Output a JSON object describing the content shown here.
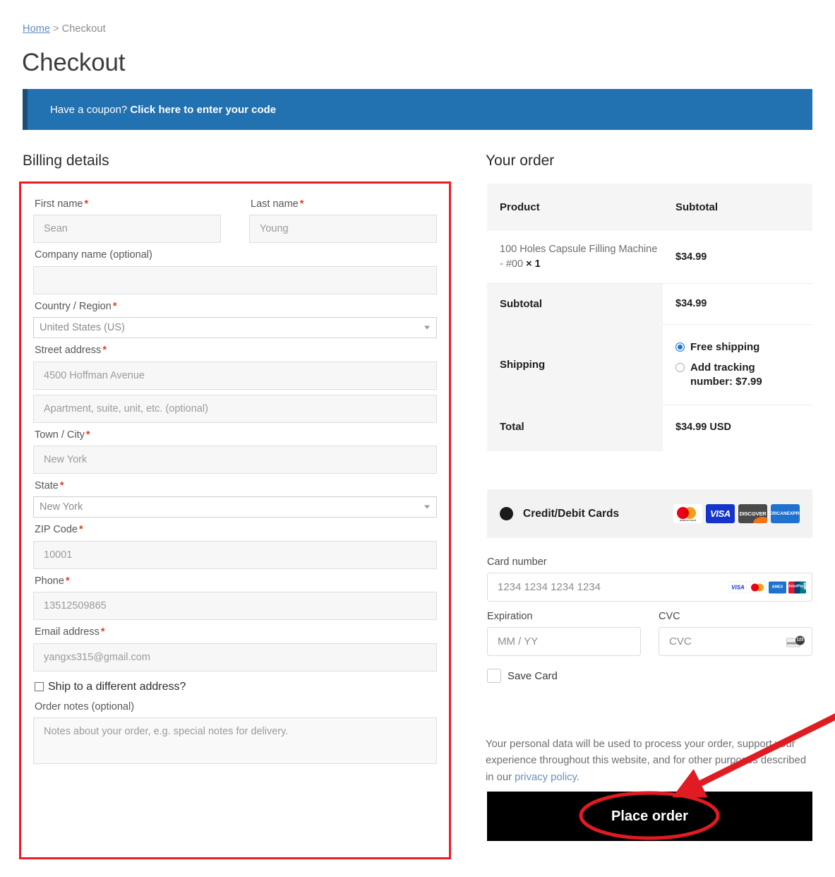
{
  "breadcrumb": {
    "home": "Home",
    "separator": ">",
    "current": "Checkout"
  },
  "page_title": "Checkout",
  "coupon": {
    "prompt": "Have a coupon?",
    "link": "Click here to enter your code",
    "background_color": "#2271b1",
    "accent_color": "#1b4f77"
  },
  "billing": {
    "heading": "Billing details",
    "first_name": {
      "label": "First name",
      "required": "*",
      "placeholder": "Sean",
      "value": ""
    },
    "last_name": {
      "label": "Last name",
      "required": "*",
      "placeholder": "Young",
      "value": ""
    },
    "company": {
      "label": "Company name (optional)",
      "placeholder": "",
      "value": ""
    },
    "country": {
      "label": "Country / Region",
      "required": "*",
      "value": "United States (US)"
    },
    "street": {
      "label": "Street address",
      "required": "*",
      "placeholder": "4500 Hoffman Avenue",
      "value": ""
    },
    "apartment": {
      "placeholder": "Apartment, suite, unit, etc. (optional)",
      "value": ""
    },
    "city": {
      "label": "Town / City",
      "required": "*",
      "placeholder": "New York",
      "value": ""
    },
    "state": {
      "label": "State",
      "required": "*",
      "value": "New York"
    },
    "zip": {
      "label": "ZIP Code",
      "required": "*",
      "placeholder": "10001",
      "value": ""
    },
    "phone": {
      "label": "Phone",
      "required": "*",
      "placeholder": "13512509865",
      "value": ""
    },
    "email": {
      "label": "Email address",
      "required": "*",
      "placeholder": "yangxs315@gmail.com",
      "value": ""
    },
    "ship_different": {
      "label": "Ship to a different address?",
      "checked": false
    },
    "order_notes": {
      "label": "Order notes (optional)",
      "placeholder": "Notes about your order, e.g. special notes for delivery.",
      "value": ""
    }
  },
  "order": {
    "heading": "Your order",
    "columns": {
      "product": "Product",
      "subtotal": "Subtotal"
    },
    "items": [
      {
        "name": "100 Holes Capsule Filling Machine - #00",
        "quantity_sep": "×",
        "quantity": "1",
        "subtotal": "$34.99"
      }
    ],
    "subtotal": {
      "label": "Subtotal",
      "value": "$34.99"
    },
    "shipping": {
      "label": "Shipping",
      "options": [
        {
          "label": "Free shipping",
          "selected": true
        },
        {
          "label": "Add tracking number: $7.99",
          "selected": false
        }
      ]
    },
    "total": {
      "label": "Total",
      "value": "$34.99 USD"
    }
  },
  "payment": {
    "method_label": "Credit/Debit Cards",
    "accepted_logos": [
      "mastercard",
      "visa",
      "discover",
      "american-express"
    ],
    "logo_text": {
      "mastercard": "mastercard",
      "visa": "VISA",
      "discover": "DISC⊙VER",
      "amex_line1": "AMERICAN",
      "amex_line2": "EXPRESS"
    },
    "card_number": {
      "label": "Card number",
      "placeholder": "1234 1234 1234 1234",
      "value": ""
    },
    "expiration": {
      "label": "Expiration",
      "placeholder": "MM / YY",
      "value": ""
    },
    "cvc": {
      "label": "CVC",
      "placeholder": "CVC",
      "value": "",
      "icon_digits": "123"
    },
    "inline_logos": {
      "visa": "VISA",
      "amex_line1": "AM",
      "amex_line2": "EX",
      "unionpay_line1": "UnionPay",
      "unionpay_line2": "银联"
    },
    "save_card": {
      "label": "Save Card",
      "checked": false
    }
  },
  "privacy": {
    "text_before": "Your personal data will be used to process your order, support your experience throughout this website, and for other purposes described in our ",
    "link": "privacy policy",
    "text_after": "."
  },
  "place_order": {
    "label": "Place order",
    "background_color": "#000000",
    "text_color": "#ffffff"
  },
  "annotations": {
    "highlight_color": "#ee1c23",
    "form_box": "red rectangle around billing details form",
    "arrow": "red arrow pointing to place order button",
    "ellipse": "red ellipse around place order button"
  }
}
